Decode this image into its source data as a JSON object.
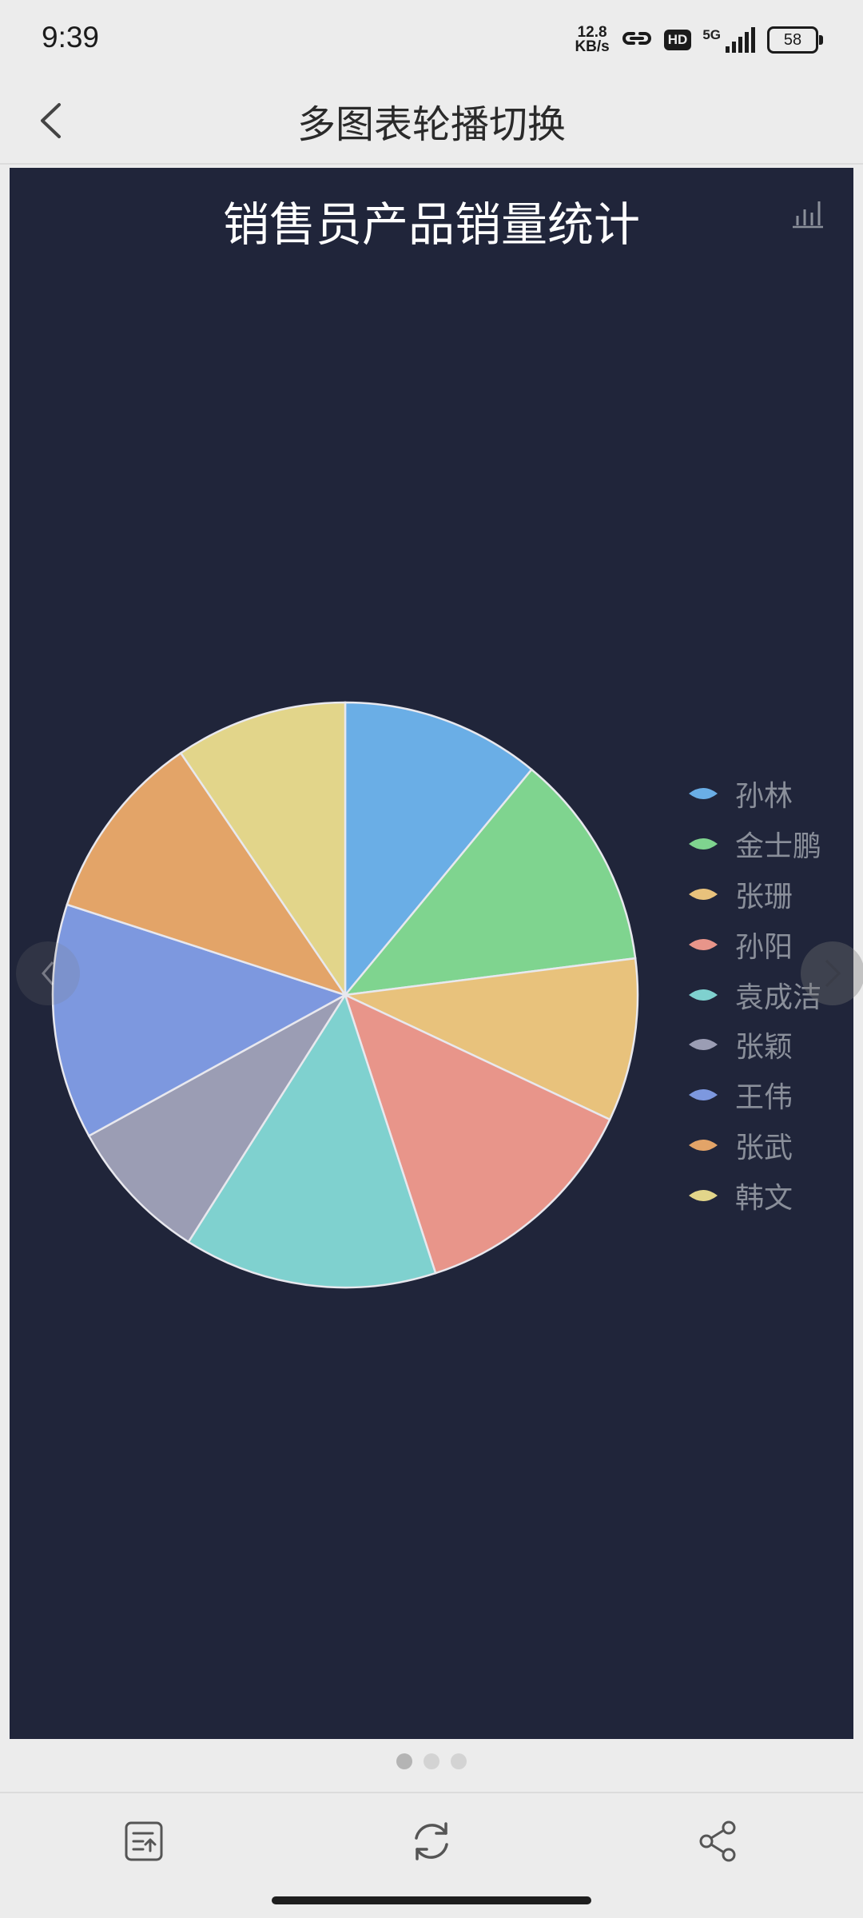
{
  "status_bar": {
    "time": "9:39",
    "net_speed_value": "12.8",
    "net_speed_unit": "KB/s",
    "hd_label": "HD",
    "network_label": "5G",
    "battery": "58"
  },
  "app_bar": {
    "title": "多图表轮播切换"
  },
  "chart_data": {
    "type": "pie",
    "title": "销售员产品销量统计",
    "legend_position": "right",
    "series": [
      {
        "name": "孙林",
        "value": 11,
        "color": "#6aaee6"
      },
      {
        "name": "金士鹏",
        "value": 12,
        "color": "#7fd48f"
      },
      {
        "name": "张珊",
        "value": 9,
        "color": "#e8c27c"
      },
      {
        "name": "孙阳",
        "value": 13,
        "color": "#e8958a"
      },
      {
        "name": "袁成洁",
        "value": 14,
        "color": "#7fd1cf"
      },
      {
        "name": "张颖",
        "value": 8,
        "color": "#9b9db4"
      },
      {
        "name": "王伟",
        "value": 13,
        "color": "#7d98df"
      },
      {
        "name": "张武",
        "value": 10.5,
        "color": "#e3a468"
      },
      {
        "name": "韩文",
        "value": 9.5,
        "color": "#e2d58a"
      }
    ]
  },
  "carousel": {
    "page_count": 3,
    "active_index": 0
  },
  "bottom_bar": {
    "icons": [
      "notes-icon",
      "refresh-icon",
      "share-icon"
    ]
  }
}
